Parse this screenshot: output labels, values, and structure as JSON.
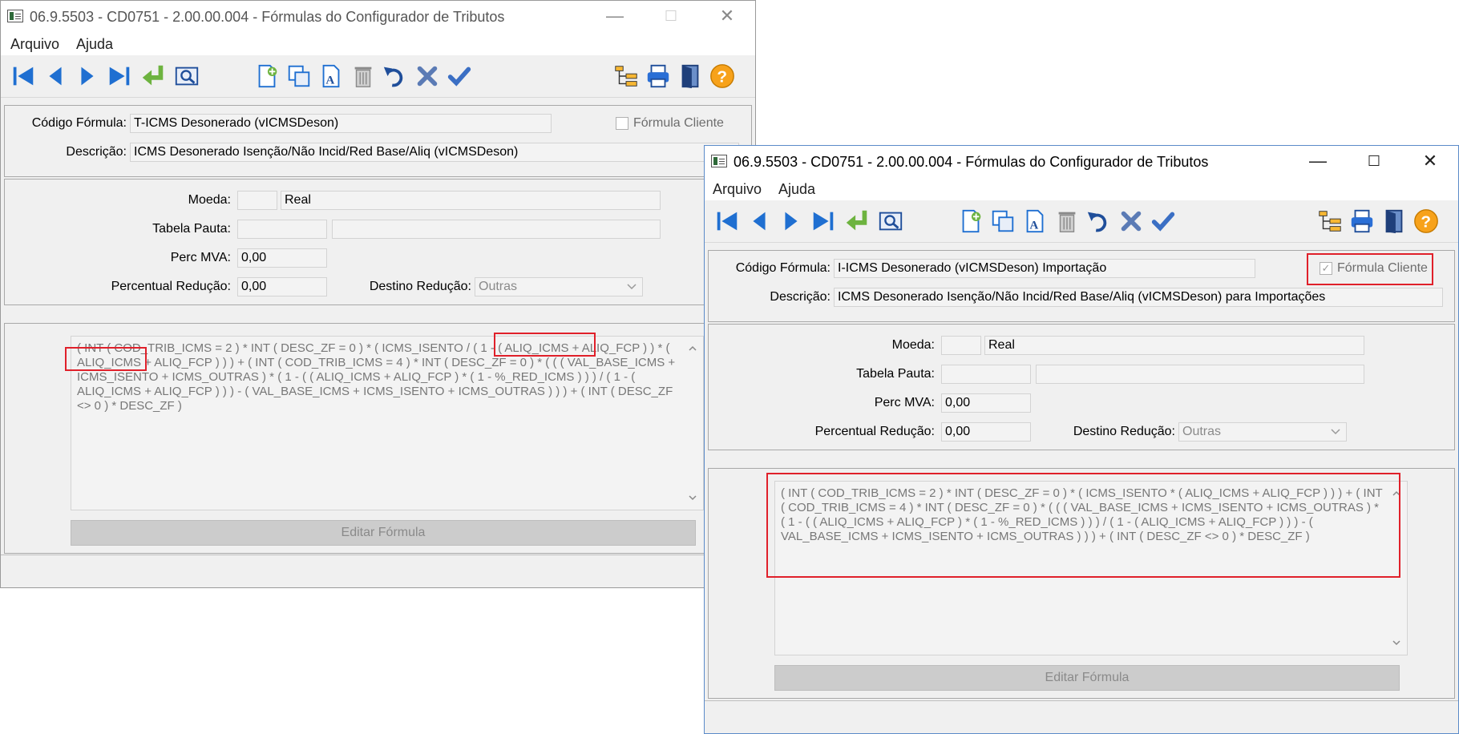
{
  "window_back": {
    "title": "06.9.5503 - CD0751 - 2.00.00.004 - Fórmulas do Configurador de Tributos",
    "menu": [
      "Arquivo",
      "Ajuda"
    ],
    "codigo_label": "Código Fórmula:",
    "codigo_value": "T-ICMS Desonerado (vICMSDeson)",
    "formula_cliente_label": "Fórmula Cliente",
    "formula_cliente_checked": false,
    "descricao_label": "Descrição:",
    "descricao_value": "ICMS Desonerado Isenção/Não Incid/Red Base/Aliq  (vICMSDeson)",
    "moeda_label": "Moeda:",
    "moeda_code": "",
    "moeda_name": "Real",
    "tabela_pauta_label": "Tabela Pauta:",
    "perc_mva_label": "Perc MVA:",
    "perc_mva_value": "0,00",
    "perc_reducao_label": "Percentual Redução:",
    "perc_reducao_value": "0,00",
    "destino_reducao_label": "Destino Redução:",
    "destino_reducao_value": "Outras",
    "formula_text": "( INT ( COD_TRIB_ICMS = 2 ) * INT ( DESC_ZF = 0 ) * ( ICMS_ISENTO / ( 1 - ( ALIQ_ICMS + ALIQ_FCP ) ) * ( ALIQ_ICMS + ALIQ_FCP ) ) ) + ( INT ( COD_TRIB_ICMS = 4 ) * INT ( DESC_ZF = 0 ) * ( ( ( VAL_BASE_ICMS + ICMS_ISENTO + ICMS_OUTRAS ) * ( 1 - ( ( ALIQ_ICMS + ALIQ_FCP ) * ( 1 - %_RED_ICMS ) ) ) / ( 1 - ( ALIQ_ICMS + ALIQ_FCP ) ) ) - ( VAL_BASE_ICMS + ICMS_ISENTO + ICMS_OUTRAS ) ) ) + ( INT ( DESC_ZF <> 0 ) * DESC_ZF )",
    "edit_button": "Editar Fórmula"
  },
  "window_front": {
    "title": "06.9.5503 - CD0751 - 2.00.00.004 - Fórmulas do Configurador de Tributos",
    "menu": [
      "Arquivo",
      "Ajuda"
    ],
    "codigo_label": "Código Fórmula:",
    "codigo_value": "I-ICMS Desonerado (vICMSDeson) Importação",
    "formula_cliente_label": "Fórmula Cliente",
    "formula_cliente_checked": true,
    "descricao_label": "Descrição:",
    "descricao_value": "ICMS Desonerado Isenção/Não Incid/Red Base/Aliq (vICMSDeson) para Importações",
    "moeda_label": "Moeda:",
    "moeda_code": "",
    "moeda_name": "Real",
    "tabela_pauta_label": "Tabela Pauta:",
    "perc_mva_label": "Perc MVA:",
    "perc_mva_value": "0,00",
    "perc_reducao_label": "Percentual Redução:",
    "perc_reducao_value": "0,00",
    "destino_reducao_label": "Destino Redução:",
    "destino_reducao_value": "Outras",
    "formula_text": "( INT ( COD_TRIB_ICMS = 2 ) * INT ( DESC_ZF = 0 ) * ( ICMS_ISENTO * ( ALIQ_ICMS + ALIQ_FCP ) ) ) + ( INT ( COD_TRIB_ICMS = 4 ) * INT ( DESC_ZF = 0 ) * ( ( ( VAL_BASE_ICMS + ICMS_ISENTO + ICMS_OUTRAS ) * ( 1 - ( ( ALIQ_ICMS + ALIQ_FCP ) * ( 1 - %_RED_ICMS ) ) ) / ( 1 - ( ALIQ_ICMS + ALIQ_FCP ) ) ) - ( VAL_BASE_ICMS + ICMS_ISENTO + ICMS_OUTRAS ) ) ) + ( INT ( DESC_ZF <> 0 ) * DESC_ZF )",
    "edit_button": "Editar Fórmula"
  },
  "toolbar_icons": [
    "first-record-icon",
    "previous-record-icon",
    "next-record-icon",
    "last-record-icon",
    "go-to-icon",
    "search-icon",
    "new-record-icon",
    "copy-record-icon",
    "edit-record-icon",
    "delete-record-icon",
    "undo-icon",
    "cancel-icon",
    "confirm-icon",
    "tree-icon",
    "print-icon",
    "exit-icon",
    "help-icon"
  ],
  "colors": {
    "highlight": "#e0202a",
    "icon_blue": "#1f6fd1",
    "icon_green": "#6db33f",
    "help_orange": "#f7a21b"
  }
}
